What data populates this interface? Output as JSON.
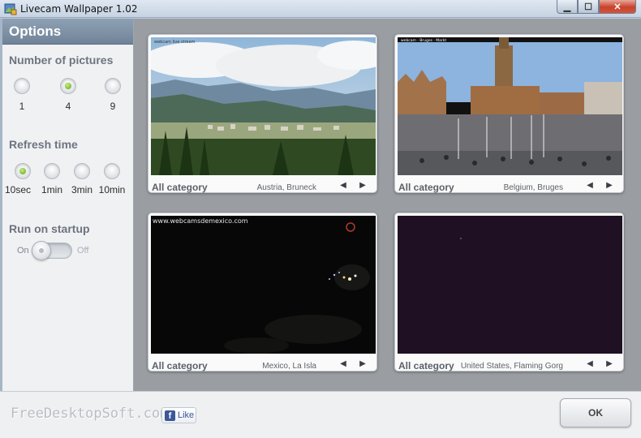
{
  "window": {
    "title": "Livecam Wallpaper 1.02",
    "minimize_glyph": "▁",
    "maximize_glyph": "☐",
    "close_glyph": "✕"
  },
  "sidebar": {
    "header": "Options",
    "number_of_pictures": {
      "title": "Number of pictures",
      "options": [
        "1",
        "4",
        "9"
      ],
      "selected": "4"
    },
    "refresh_time": {
      "title": "Refresh time",
      "options": [
        "10sec",
        "1min",
        "3min",
        "10min"
      ],
      "selected": "10sec"
    },
    "run_on_startup": {
      "title": "Run on startup",
      "on_label": "On",
      "off_label": "Off",
      "state": "on"
    }
  },
  "cams": [
    {
      "category": "All category",
      "location": "Austria, Bruneck",
      "prev_glyph": "◀",
      "next_glyph": "▶"
    },
    {
      "category": "All category",
      "location": "Belgium, Bruges",
      "prev_glyph": "◀",
      "next_glyph": "▶"
    },
    {
      "category": "All category",
      "location": "Mexico, La Isla",
      "watermark": "www.webcamsdemexico.com",
      "prev_glyph": "◀",
      "next_glyph": "▶"
    },
    {
      "category": "All category",
      "location": "United States, Flaming Gorg",
      "prev_glyph": "◀",
      "next_glyph": "▶"
    }
  ],
  "footer": {
    "brand": "FreeDesktopSoft.com",
    "fb_glyph": "f",
    "like_label": "Like",
    "ok_label": "OK"
  },
  "colors": {
    "sidebar_header": "#7e91a5",
    "radio_checked": "#6fb21e",
    "main_background": "#9a9ea3"
  }
}
